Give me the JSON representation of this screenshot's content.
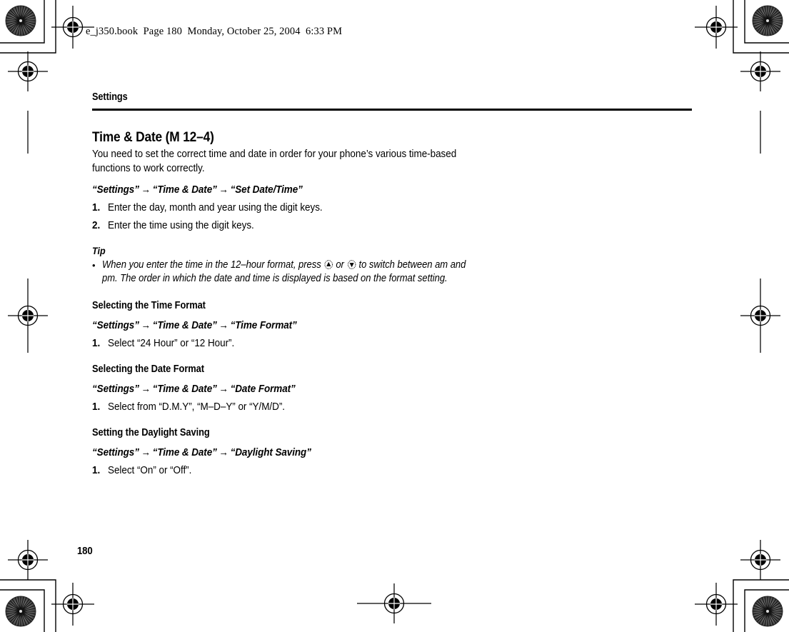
{
  "page": {
    "bookline": "e_j350.book  Page 180  Monday, October 25, 2004  6:33 PM",
    "running_head": "Settings",
    "folio": "180"
  },
  "section": {
    "title": "Time & Date (M 12–4)",
    "intro": "You need to set the correct time and date in order for your phone’s various time-based functions to work correctly."
  },
  "set_date_time": {
    "path": [
      "“Settings”",
      "“Time & Date”",
      "“Set Date/Time”"
    ],
    "steps": [
      {
        "num": "1.",
        "text": "Enter the day, month and year using the digit keys."
      },
      {
        "num": "2.",
        "text": "Enter the time using the digit keys."
      }
    ]
  },
  "tip": {
    "heading": "Tip",
    "bullet": "•",
    "text_part1": "When you enter the time in the 12–hour format, press",
    "icon_up": "navigation-up-key-icon",
    "text_or": "or",
    "icon_down": "navigation-down-key-icon",
    "text_part2": "to switch between am and pm. The order in which the date and time is displayed is based on the format setting."
  },
  "time_format": {
    "heading": "Selecting the Time Format",
    "path": [
      "“Settings”",
      "“Time & Date”",
      "“Time Format”"
    ],
    "steps": [
      {
        "num": "1.",
        "text": "Select “24 Hour” or “12 Hour”."
      }
    ]
  },
  "date_format": {
    "heading": "Selecting the Date Format",
    "path": [
      "“Settings”",
      "“Time & Date”",
      "“Date Format”"
    ],
    "steps": [
      {
        "num": "1.",
        "text": "Select from “D.M.Y”, “M–D–Y” or “Y/M/D”."
      }
    ]
  },
  "daylight_saving": {
    "heading": "Setting the Daylight Saving",
    "path": [
      "“Settings”",
      "“Time & Date”",
      "“Daylight Saving”"
    ],
    "steps": [
      {
        "num": "1.",
        "text": "Select “On” or “Off”."
      }
    ]
  },
  "arrow": "→",
  "colors": {
    "ink": "#000000",
    "paper": "#ffffff",
    "mark_gray": "#777777"
  }
}
